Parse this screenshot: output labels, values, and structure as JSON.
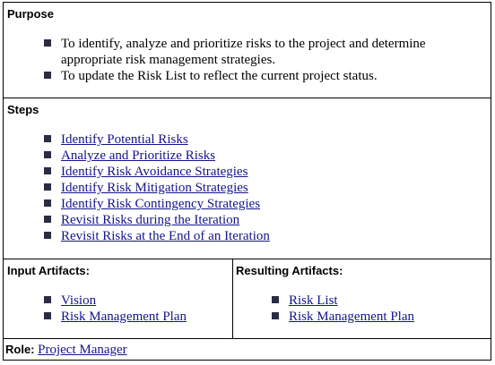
{
  "purpose": {
    "title": "Purpose",
    "items": [
      "To identify, analyze and prioritize risks to the project and determine appropriate risk management strategies.",
      "To update the Risk List to reflect the current project status."
    ]
  },
  "steps": {
    "title": "Steps",
    "links": [
      "Identify Potential Risks",
      "Analyze and Prioritize Risks",
      "Identify Risk Avoidance Strategies",
      "Identify Risk Mitigation Strategies",
      "Identify Risk Contingency Strategies",
      "Revisit Risks during the Iteration",
      "Revisit Risks at the End of an Iteration"
    ]
  },
  "input_artifacts": {
    "title": "Input Artifacts:",
    "links": [
      "Vision",
      "Risk Management Plan"
    ]
  },
  "resulting_artifacts": {
    "title": "Resulting Artifacts:",
    "links": [
      "Risk List",
      "Risk Management Plan"
    ]
  },
  "role": {
    "label": "Role:",
    "link": "Project Manager"
  },
  "colors": {
    "link": "#14148c",
    "bullet": "#2b2b45",
    "border": "#000000"
  }
}
